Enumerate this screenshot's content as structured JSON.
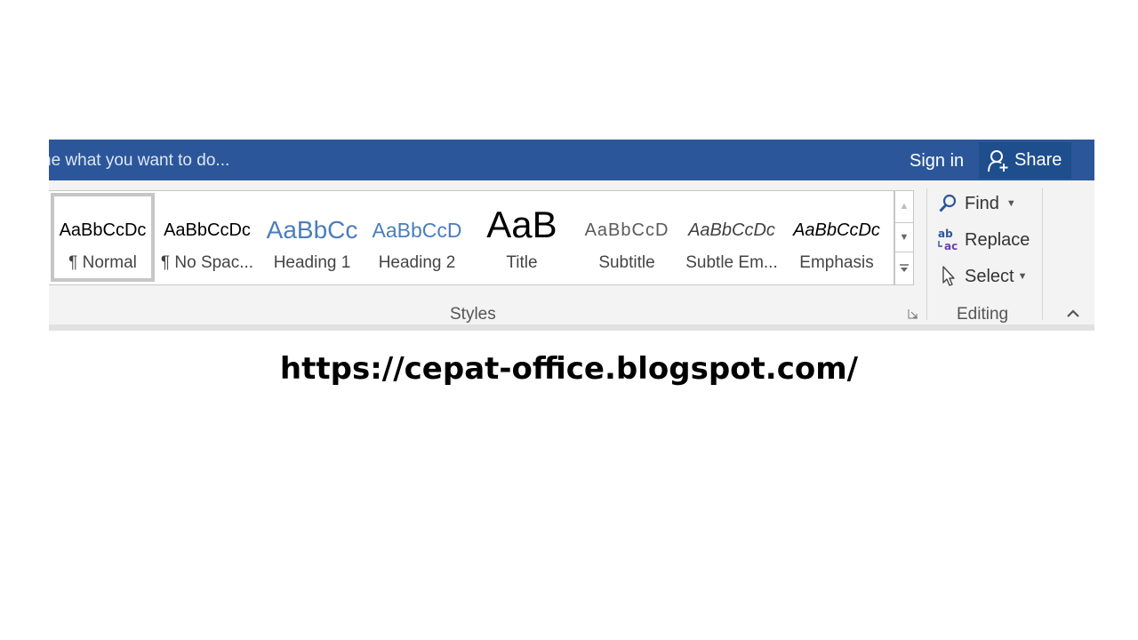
{
  "titlebar": {
    "tell_me": "ne what you want to do...",
    "sign_in": "Sign in",
    "share": "Share",
    "background": "#2b579a"
  },
  "styles_group": {
    "label": "Styles",
    "items": [
      {
        "preview": "AaBbCcDc",
        "label": "¶ Normal",
        "selected": true
      },
      {
        "preview": "AaBbCcDc",
        "label": "¶ No Spac..."
      },
      {
        "preview": "AaBbCc",
        "label": "Heading 1"
      },
      {
        "preview": "AaBbCcD",
        "label": "Heading 2"
      },
      {
        "preview": "AaB",
        "label": "Title"
      },
      {
        "preview": "AaBbCcD",
        "label": "Subtitle"
      },
      {
        "preview": "AaBbCcDc",
        "label": "Subtle Em..."
      },
      {
        "preview": "AaBbCcDc",
        "label": "Emphasis"
      }
    ]
  },
  "editing_group": {
    "label": "Editing",
    "find": "Find",
    "replace": "Replace",
    "select": "Select"
  },
  "caption": {
    "url": "https://cepat-office.blogspot.com/"
  },
  "icons": {
    "share": "person-plus-icon",
    "find": "magnifier-icon",
    "replace": "ab-ac-replace-icon",
    "select": "cursor-arrow-icon",
    "collapse": "chevron-up-icon",
    "launcher": "dialog-launcher-icon"
  }
}
